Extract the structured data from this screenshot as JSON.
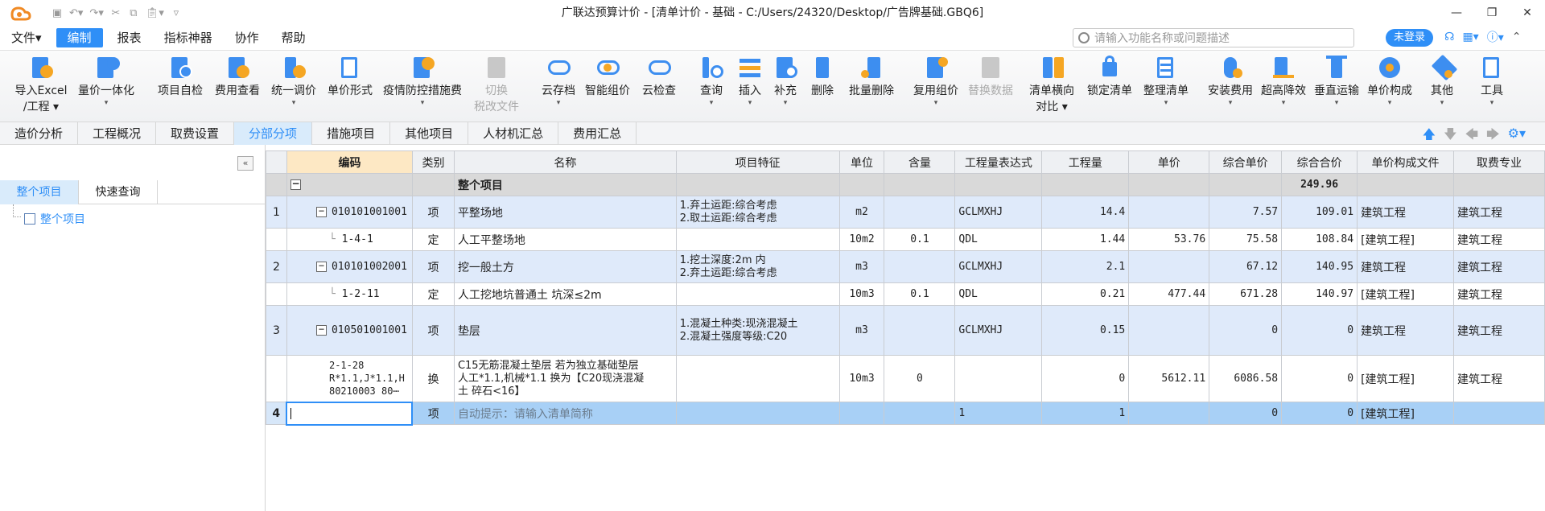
{
  "window": {
    "title": "广联达预算计价 - [清单计价 - 基础 - C:/Users/24320/Desktop/广告牌基础.GBQ6]",
    "controls": [
      "—",
      "❐",
      "✕"
    ]
  },
  "menu": {
    "items": [
      "文件▾",
      "编制",
      "报表",
      "指标神器",
      "协作",
      "帮助"
    ],
    "search_placeholder": "请输入功能名称或问题描述",
    "login": "未登录"
  },
  "ribbon": [
    {
      "label": "导入Excel",
      "sub": "/工程"
    },
    {
      "label": "量价一体化"
    },
    {
      "label": "项目自检"
    },
    {
      "label": "费用查看"
    },
    {
      "label": "统一调价"
    },
    {
      "label": "单价形式"
    },
    {
      "label": "疫情防控措施费"
    },
    {
      "label": "切换",
      "sub": "税改文件"
    },
    {
      "label": "云存档"
    },
    {
      "label": "智能组价"
    },
    {
      "label": "云检查"
    },
    {
      "label": "查询"
    },
    {
      "label": "插入"
    },
    {
      "label": "补充"
    },
    {
      "label": "删除"
    },
    {
      "label": "批量删除"
    },
    {
      "label": "复用组价"
    },
    {
      "label": "替换数据"
    },
    {
      "label": "清单横向",
      "sub": "对比"
    },
    {
      "label": "锁定清单"
    },
    {
      "label": "整理清单"
    },
    {
      "label": "安装费用"
    },
    {
      "label": "超高降效"
    },
    {
      "label": "垂直运输"
    },
    {
      "label": "单价构成"
    },
    {
      "label": "其他"
    },
    {
      "label": "工具"
    }
  ],
  "tabs": [
    "造价分析",
    "工程概况",
    "取费设置",
    "分部分项",
    "措施项目",
    "其他项目",
    "人材机汇总",
    "费用汇总"
  ],
  "left": {
    "tabs": [
      "整个项目",
      "快速查询"
    ],
    "tree_item": "整个项目"
  },
  "grid": {
    "headers": [
      "",
      "编码",
      "类别",
      "名称",
      "项目特征",
      "单位",
      "含量",
      "工程量表达式",
      "工程量",
      "单价",
      "综合单价",
      "综合合价",
      "单价构成文件",
      "取费专业"
    ],
    "group_row": {
      "toggle": "−",
      "name": "整个项目",
      "total": "249.96"
    },
    "rows": [
      {
        "num": "1",
        "code": "010101001001",
        "type": "项",
        "name": "平整场地",
        "feature1": "1.弃土运距:综合考虑",
        "feature2": "2.取土运距:综合考虑",
        "unit": "m2",
        "content": "",
        "expr": "GCLMXHJ",
        "qty": "14.4",
        "price": "",
        "uprice": "7.57",
        "total": "109.01",
        "file": "建筑工程",
        "major": "建筑工程"
      },
      {
        "num": "",
        "code": "1-4-1",
        "type": "定",
        "name": "人工平整场地",
        "feature1": "",
        "feature2": "",
        "unit": "10m2",
        "content": "0.1",
        "expr": "QDL",
        "qty": "1.44",
        "price": "53.76",
        "uprice": "75.58",
        "total": "108.84",
        "file": "[建筑工程]",
        "major": "建筑工程"
      },
      {
        "num": "2",
        "code": "010101002001",
        "type": "项",
        "name": "挖一般土方",
        "feature1": "1.挖土深度:2m 内",
        "feature2": "2.弃土运距:综合考虑",
        "unit": "m3",
        "content": "",
        "expr": "GCLMXHJ",
        "qty": "2.1",
        "price": "",
        "uprice": "67.12",
        "total": "140.95",
        "file": "建筑工程",
        "major": "建筑工程"
      },
      {
        "num": "",
        "code": "1-2-11",
        "type": "定",
        "name": "人工挖地坑普通土 坑深≤2m",
        "feature1": "",
        "feature2": "",
        "unit": "10m3",
        "content": "0.1",
        "expr": "QDL",
        "qty": "0.21",
        "price": "477.44",
        "uprice": "671.28",
        "total": "140.97",
        "file": "[建筑工程]",
        "major": "建筑工程"
      },
      {
        "num": "3",
        "code": "010501001001",
        "type": "项",
        "name": "垫层",
        "feature1": "1.混凝土种类:现浇混凝土",
        "feature2": "2.混凝土强度等级:C20",
        "unit": "m3",
        "content": "",
        "expr": "GCLMXHJ",
        "qty": "0.15",
        "price": "",
        "uprice": "0",
        "total": "0",
        "file": "建筑工程",
        "major": "建筑工程"
      },
      {
        "num": "",
        "code1": "2-1-28",
        "code2": "R*1.1,J*1.1,H",
        "code3": "80210003 80⋯",
        "type": "换",
        "name1": "C15无筋混凝土垫层  若为独立基础垫层",
        "name2": "人工*1.1,机械*1.1  换为【C20现浇混凝",
        "name3": "土 碎石<16】",
        "unit": "10m3",
        "content": "0",
        "expr": "",
        "qty": "0",
        "price": "5612.11",
        "uprice": "6086.58",
        "total": "0",
        "file": "[建筑工程]",
        "major": "建筑工程"
      },
      {
        "num": "4",
        "code": "",
        "type": "项",
        "name": "自动提示：请输入清单简称",
        "unit": "",
        "content": "",
        "expr": "1",
        "qty": "1",
        "price": "",
        "uprice": "0",
        "total": "0",
        "file": "[建筑工程]",
        "major": ""
      }
    ]
  }
}
